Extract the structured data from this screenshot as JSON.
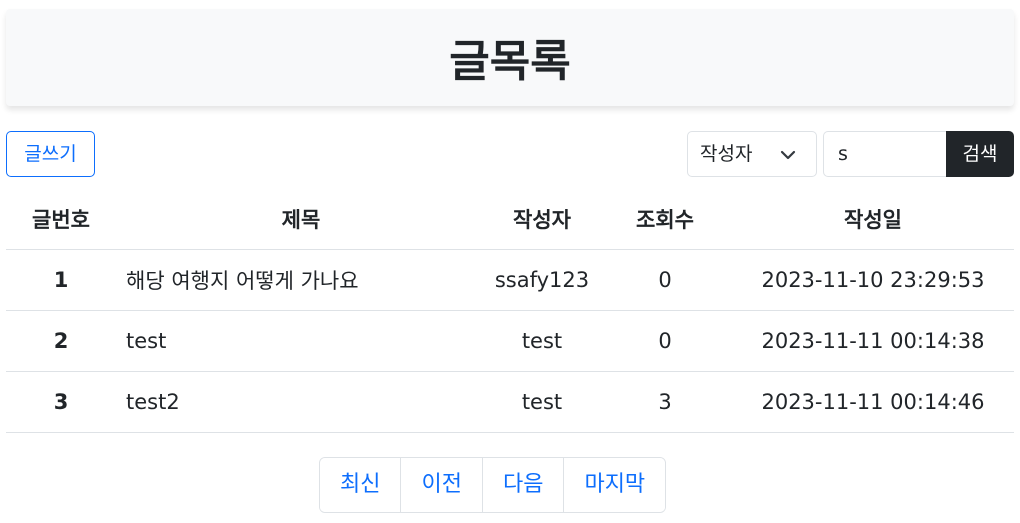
{
  "header": {
    "title": "글목록"
  },
  "toolbar": {
    "write_label": "글쓰기",
    "search_key": "작성자",
    "search_value": "s",
    "search_label": "검색"
  },
  "table": {
    "headers": [
      "글번호",
      "제목",
      "작성자",
      "조회수",
      "작성일"
    ],
    "rows": [
      {
        "no": "1",
        "title": "해당 여행지 어떻게 가나요",
        "writer": "ssafy123",
        "views": "0",
        "date": "2023-11-10 23:29:53"
      },
      {
        "no": "2",
        "title": "test",
        "writer": "test",
        "views": "0",
        "date": "2023-11-11 00:14:38"
      },
      {
        "no": "3",
        "title": "test2",
        "writer": "test",
        "views": "3",
        "date": "2023-11-11 00:14:46"
      }
    ]
  },
  "pager": {
    "first": "최신",
    "prev": "이전",
    "next": "다음",
    "last": "마지막"
  },
  "colors": {
    "accent": "#0d6efd",
    "highlight": "#9effff",
    "dark": "#212529"
  }
}
